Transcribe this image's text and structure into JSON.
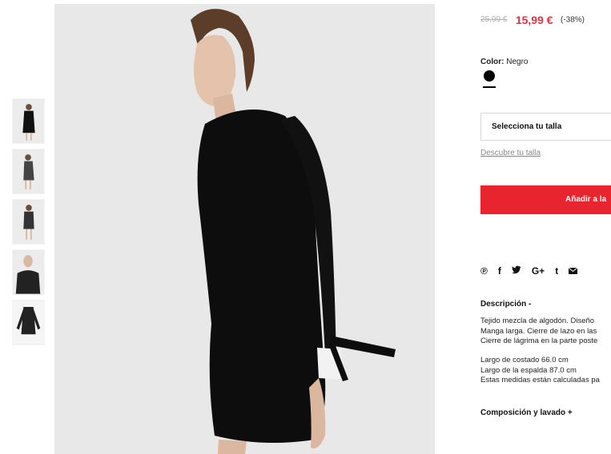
{
  "product": {
    "old_price": "25,99 €",
    "new_price": "15,99 €",
    "discount": "(-38%)",
    "color_label": "Color:",
    "color_value": "Negro",
    "size_select": "Selecciona tu talla",
    "size_guide": "Descubre tu talla",
    "add_to_cart": "Añadir a la",
    "social_icons": [
      "pinterest-icon",
      "facebook-icon",
      "twitter-icon",
      "google-plus-icon",
      "tumblr-icon",
      "email-icon"
    ],
    "social_glyphs": [
      "℗",
      "f",
      "♥",
      "G+",
      "t",
      "✉"
    ],
    "description_title": "Descripción -",
    "description_lines": [
      "Tejido mezcla de algodón. Diseño",
      "Manga larga. Cierre de lazo en las",
      "Cierre de lágrima en la parte poste"
    ],
    "measure_lines": [
      "Largo de costado 66.0 cm",
      "Largo de la espalda 87.0 cm",
      "Estas medidas están calculadas pa"
    ],
    "composition_title": "Composición y lavado +"
  },
  "colors": {
    "accent": "#e8242f",
    "sale_price": "#e6303f",
    "swatch": "#000000"
  }
}
